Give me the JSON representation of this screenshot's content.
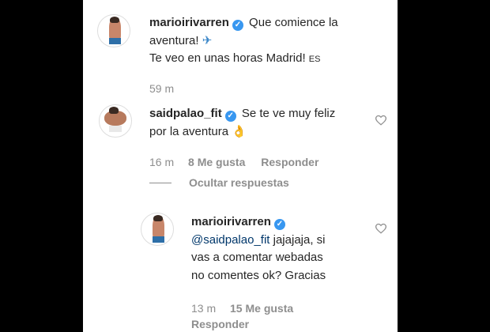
{
  "comment1": {
    "username": "marioirivarren",
    "text_line1": " Que comience la",
    "text_line2": "aventura! ",
    "emoji": "✈",
    "text_line3": "Te veo en unas horas Madrid! ",
    "flag": "ES",
    "time": "59 m"
  },
  "comment2": {
    "username": "saidpalao_fit",
    "text_line1": " Se te ve muy feliz",
    "text_line2": "por la aventura ",
    "emoji": "👌",
    "time": "16 m",
    "likes": "8 Me gusta",
    "reply": "Responder"
  },
  "hide_replies": "Ocultar respuestas",
  "reply1": {
    "username": "marioirivarren",
    "mention": "@saidpalao_fit",
    "text_line1": " jajajaja, si",
    "text_line2": "vas a comentar webadas",
    "text_line3": "no comentes ok? Gracias",
    "time": "13 m",
    "likes": "15 Me gusta",
    "reply": "Responder"
  },
  "icons": {
    "verified": "verified-badge-icon",
    "heart": "heart-outline-icon"
  },
  "colors": {
    "verified": "#3897f0",
    "mention": "#00376b",
    "meta": "#8e8e8e"
  }
}
